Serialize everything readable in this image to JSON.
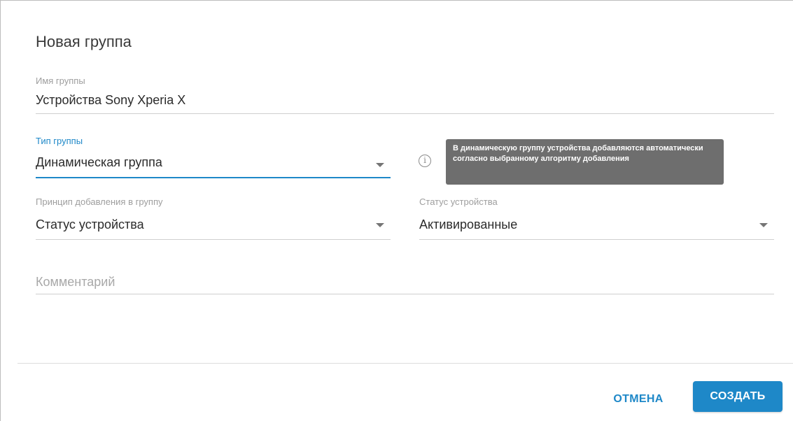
{
  "dialog": {
    "title": "Новая группа"
  },
  "form": {
    "group_name": {
      "label": "Имя группы",
      "value": "Устройства Sony Xperia X"
    },
    "group_type": {
      "label": "Тип группы",
      "value": "Динамическая группа",
      "icon": "chevron-down-icon"
    },
    "info": {
      "icon": "info-icon",
      "tooltip": "В динамическую группу устройства добавляются автоматически согласно выбранному алгоритму добавления"
    },
    "add_principle": {
      "label": "Принцип добавления в группу",
      "value": "Статус устройства",
      "icon": "chevron-down-icon"
    },
    "device_status": {
      "label": "Статус устройства",
      "value": "Активированные",
      "icon": "chevron-down-icon"
    },
    "comment": {
      "placeholder": "Комментарий"
    }
  },
  "actions": {
    "cancel_label": "ОТМЕНА",
    "create_label": "СОЗДАТЬ"
  },
  "colors": {
    "accent": "#1e88c8",
    "tooltip_bg": "#6e6e6e"
  }
}
